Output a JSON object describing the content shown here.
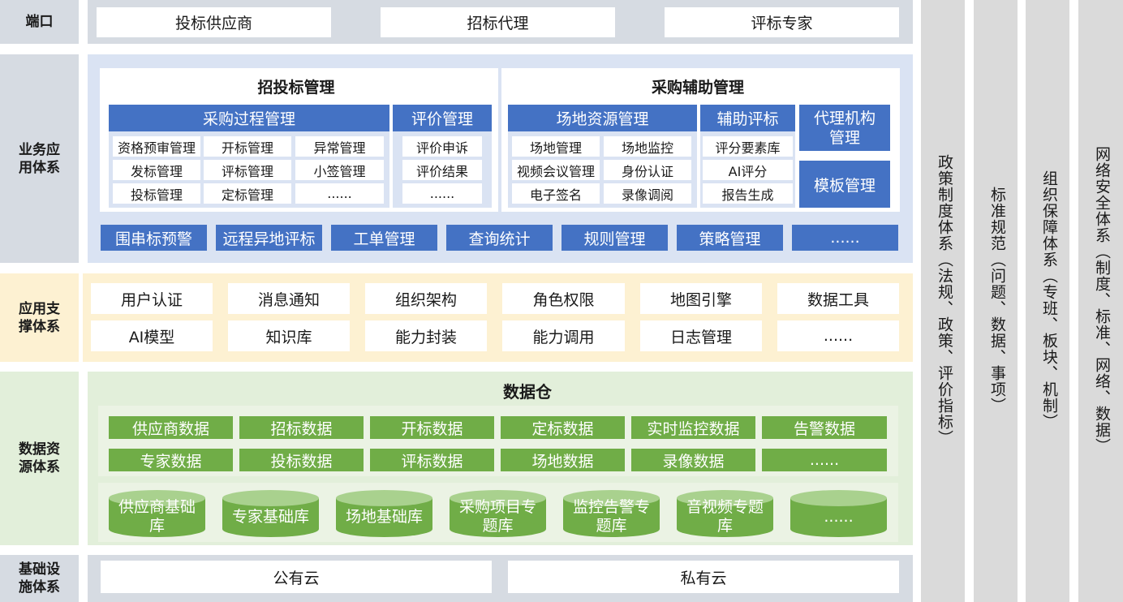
{
  "rows": {
    "portal": "端口",
    "business": "业务应\n用体系",
    "support": "应用支\n撑体系",
    "data": "数据资\n源体系",
    "infra": "基础设\n施体系"
  },
  "portal_items": [
    "投标供应商",
    "招标代理",
    "评标专家"
  ],
  "bidding": {
    "title": "招投标管理",
    "process": {
      "header": "采购过程管理",
      "cells": [
        [
          "资格预审管理",
          "开标管理",
          "异常管理"
        ],
        [
          "发标管理",
          "评标管理",
          "小签管理"
        ],
        [
          "投标管理",
          "定标管理",
          "......"
        ]
      ]
    },
    "evaluation": {
      "header": "评价管理",
      "cells": [
        "评价申诉",
        "评价结果",
        "......"
      ]
    }
  },
  "aux": {
    "title": "采购辅助管理",
    "venue": {
      "header": "场地资源管理",
      "cells": [
        [
          "场地管理",
          "场地监控"
        ],
        [
          "视频会议管理",
          "身份认证"
        ],
        [
          "电子签名",
          "录像调阅"
        ]
      ]
    },
    "assist": {
      "header": "辅助评标",
      "cells": [
        "评分要素库",
        "AI评分",
        "报告生成"
      ]
    },
    "agency": "代理机构\n管理",
    "template": "模板管理"
  },
  "business_bottom": [
    "围串标预警",
    "远程异地评标",
    "工单管理",
    "查询统计",
    "规则管理",
    "策略管理",
    "......"
  ],
  "support_items": [
    [
      "用户认证",
      "消息通知",
      "组织架构",
      "角色权限",
      "地图引擎",
      "数据工具"
    ],
    [
      "AI模型",
      "知识库",
      "能力封装",
      "能力调用",
      "日志管理",
      "......"
    ]
  ],
  "warehouse": {
    "title": "数据仓",
    "data_rows": [
      [
        "供应商数据",
        "招标数据",
        "开标数据",
        "定标数据",
        "实时监控数据",
        "告警数据"
      ],
      [
        "专家数据",
        "投标数据",
        "评标数据",
        "场地数据",
        "录像数据",
        "......"
      ]
    ],
    "databases": [
      "供应商基础\n库",
      "专家基础库",
      "场地基础库",
      "采购项目专\n题库",
      "监控告警专\n题库",
      "音视频专题\n库",
      "......"
    ]
  },
  "infra_items": [
    "公有云",
    "私有云"
  ],
  "side_columns": [
    "政策制度体系（法规、政策、评价指标）",
    "标准规范（问题、数据、事项）",
    "组织保障体系（专班、板块、机制）",
    "网络安全体系（制度、标准、网络、数据）"
  ],
  "colors": {
    "blue": "#4472c4",
    "green": "#70ad47",
    "green_top": "#a9d18e",
    "gray_band": "#d6dbe2",
    "yellow_band": "#fdf1d2",
    "green_band": "#e2efda",
    "side_col": "#dadada"
  }
}
